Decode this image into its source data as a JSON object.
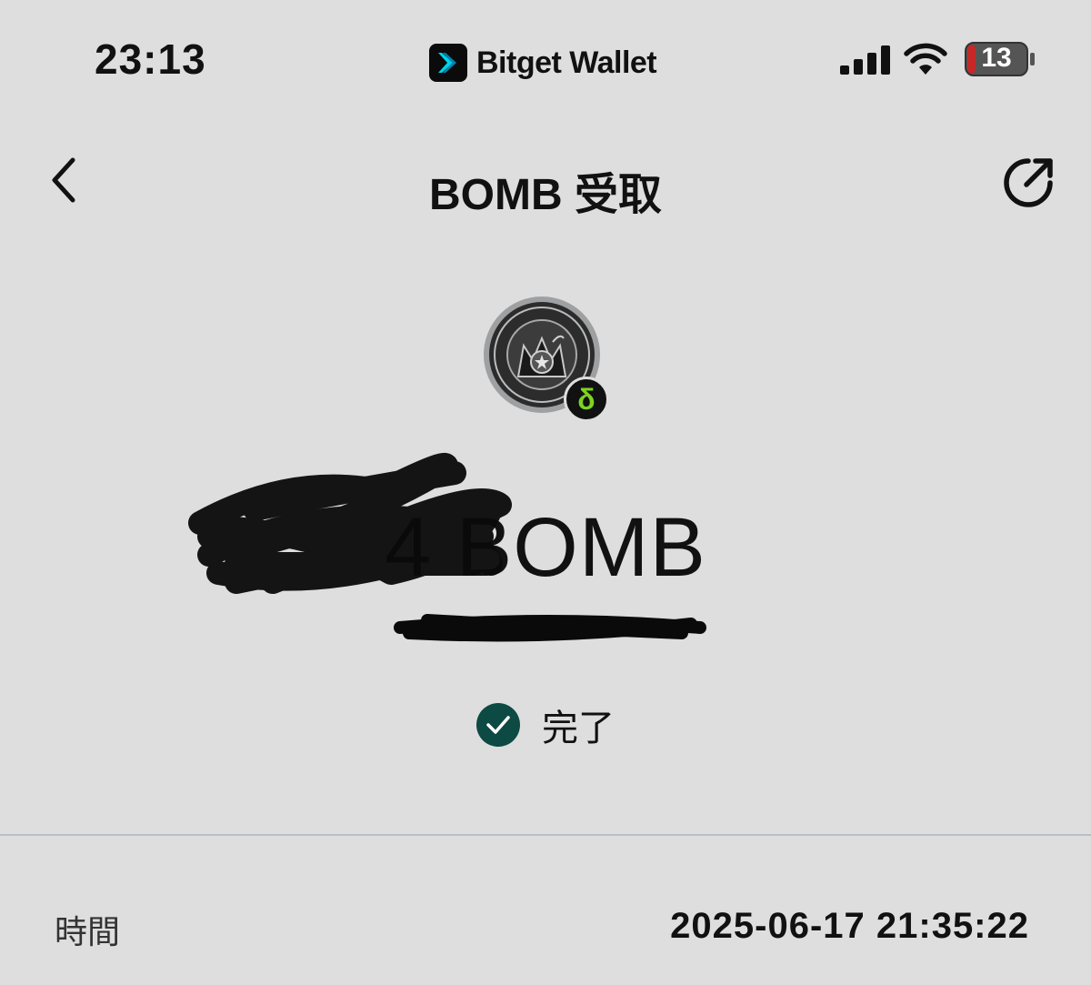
{
  "status_bar": {
    "time": "23:13",
    "app_name": "Bitget Wallet",
    "battery_level": "13"
  },
  "nav": {
    "title": "BOMB 受取"
  },
  "transaction": {
    "amount_visible": "4",
    "token_symbol": "BOMB",
    "status": "完了"
  },
  "details": {
    "time_label": "時間",
    "time_value": "2025-06-17 21:35:22"
  },
  "colors": {
    "background": "#dedede",
    "status_check": "#0c4a43",
    "chain_badge_accent": "#7cd420",
    "battery_low": "#c62828",
    "divider": "#b9bfc6"
  },
  "icons": {
    "back": "chevron-left-icon",
    "share": "share-icon",
    "status": "check-circle-icon"
  }
}
